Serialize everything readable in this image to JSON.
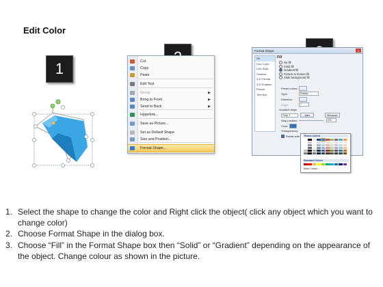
{
  "title": "Edit Color",
  "badges": [
    "1",
    "2",
    "3"
  ],
  "menu": {
    "items": [
      {
        "label": "Cut",
        "key": "cut",
        "disabled": false,
        "submenu": false,
        "highlight": false
      },
      {
        "label": "Copy",
        "key": "copy",
        "disabled": false,
        "submenu": false,
        "highlight": false
      },
      {
        "label": "Paste",
        "key": "paste",
        "disabled": false,
        "submenu": false,
        "highlight": false
      },
      {
        "label": "Edit Text",
        "key": "edit-text",
        "disabled": false,
        "submenu": false,
        "highlight": false
      },
      {
        "label": "Group",
        "key": "group",
        "disabled": true,
        "submenu": true,
        "highlight": false
      },
      {
        "label": "Bring to Front",
        "key": "bring-to-front",
        "disabled": false,
        "submenu": true,
        "highlight": false
      },
      {
        "label": "Send to Back",
        "key": "send-to-back",
        "disabled": false,
        "submenu": true,
        "highlight": false
      },
      {
        "label": "Hyperlink...",
        "key": "hyperlink",
        "disabled": false,
        "submenu": false,
        "highlight": false
      },
      {
        "label": "Save as Picture...",
        "key": "save-as-picture",
        "disabled": false,
        "submenu": false,
        "highlight": false
      },
      {
        "label": "Set as Default Shape",
        "key": "set-default-shape",
        "disabled": false,
        "submenu": false,
        "highlight": false
      },
      {
        "label": "Size and Position...",
        "key": "size-and-position",
        "disabled": false,
        "submenu": false,
        "highlight": false
      },
      {
        "label": "Format Shape...",
        "key": "format-shape",
        "disabled": false,
        "submenu": false,
        "highlight": true
      }
    ]
  },
  "dialog": {
    "title": "Format Shape",
    "close": "x",
    "sidebar": [
      "Fill",
      "Line Color",
      "Line Style",
      "Shadow",
      "3-D Format",
      "3-D Rotation",
      "Picture",
      "Text Box"
    ],
    "fill_heading": "Fill",
    "fill_options": [
      "No fill",
      "Solid fill",
      "Gradient fill",
      "Picture or texture fill",
      "Slide background fill"
    ],
    "fill_selected": 2,
    "preset_colors": "Preset colors:",
    "type": "Type:",
    "type_value": "Radial",
    "direction": "Direction:",
    "angle": "Angle:",
    "angle_value": "0°",
    "gradient_stops": "Gradient stops",
    "stop": "Stop 1",
    "add": "Add",
    "remove": "Remove",
    "stop_position": "Stop position:",
    "stop_position_value": "0%",
    "color": "Color:",
    "transparency": "Transparency:",
    "rotate": "Rotate with shape"
  },
  "palette": {
    "theme_label": "Theme Colors",
    "standard_label": "Standard Colors",
    "more": "More Colors...",
    "theme_top": [
      "#ffffff",
      "#000000",
      "#eeece1",
      "#1f497d",
      "#4f81bd",
      "#c0504d",
      "#9bbb59",
      "#8064a2",
      "#4bacc6",
      "#f79646"
    ],
    "standard": [
      "#c00000",
      "#ff0000",
      "#ffc000",
      "#ffff00",
      "#92d050",
      "#00b050",
      "#00b0f0",
      "#0070c0",
      "#002060",
      "#7030a0"
    ]
  },
  "steps": [
    {
      "n": "1.",
      "text": "Select the shape to change the color and Right click the object( click any object which you want to change color)"
    },
    {
      "n": "2.",
      "text": "Choose Format Shape in the dialog box."
    },
    {
      "n": "3.",
      "text": "Choose “Fill” in the Format Shape box then “Solid” or “Gradient” depending on the appearance of the object. Change colour as shown in the picture."
    }
  ]
}
